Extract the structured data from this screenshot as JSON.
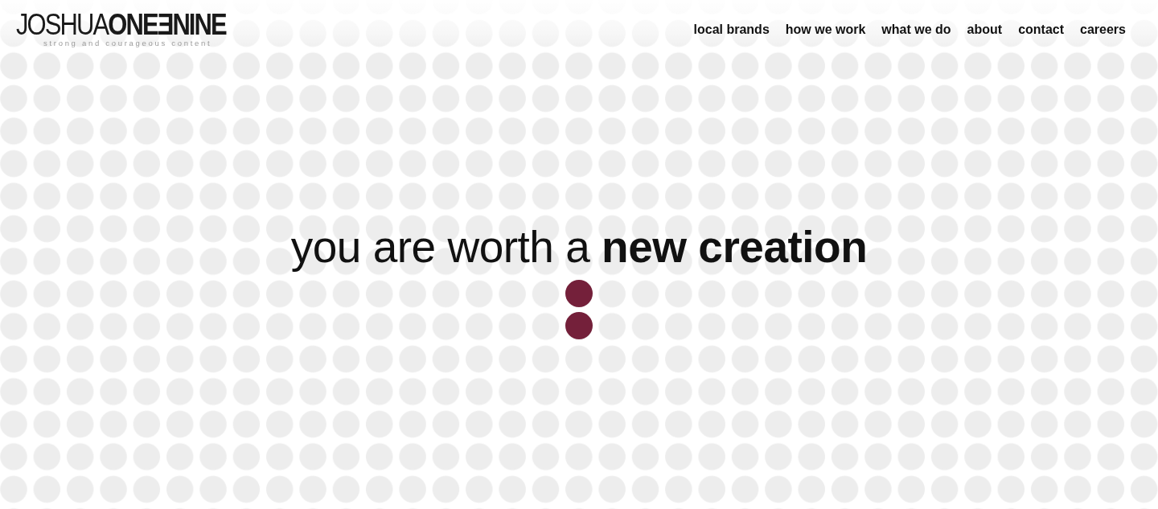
{
  "logo": {
    "wordmark": "JOSHUA**ONEƎNINE**",
    "tagline": "strong and courageous content"
  },
  "nav": [
    "local brands",
    "how we work",
    "what we do",
    "about",
    "contact",
    "careers"
  ],
  "hero": {
    "headline": "you are worth a **new creation**"
  }
}
